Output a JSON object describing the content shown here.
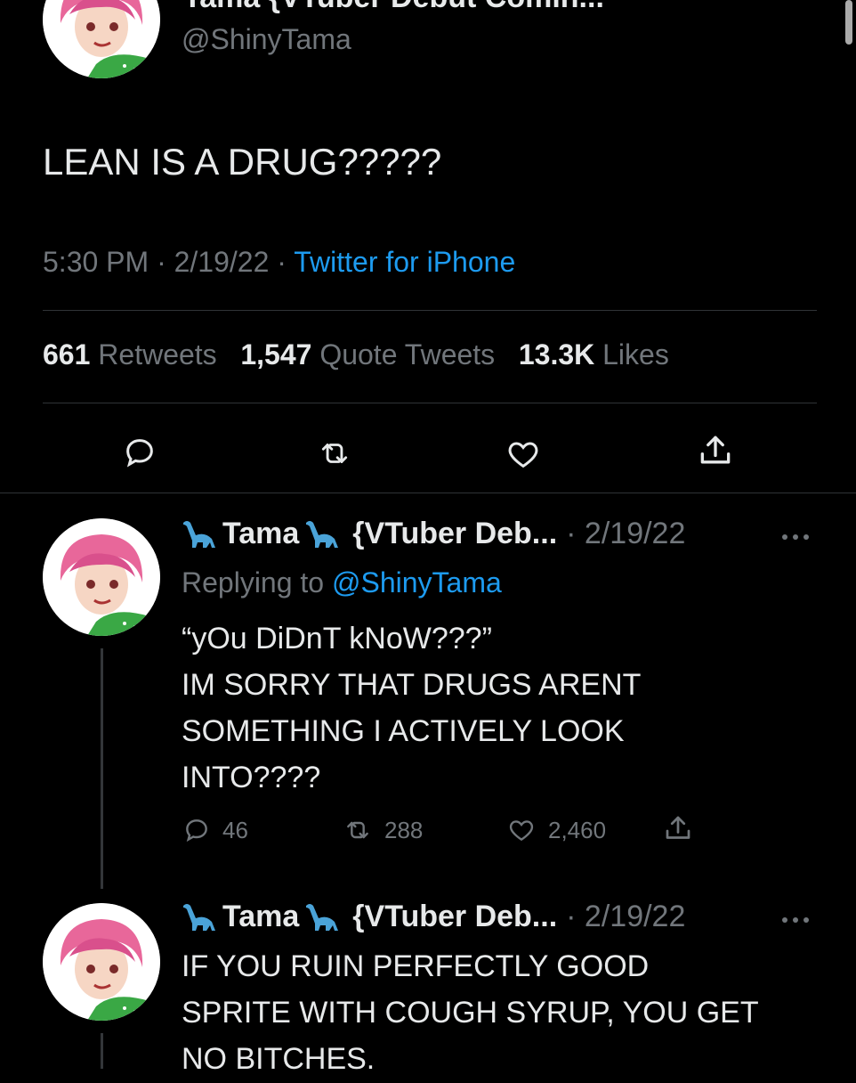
{
  "main_tweet": {
    "header_cut": "Tama  {VTuber Debut Comin...",
    "handle": "@ShinyTama",
    "text": "LEAN IS A DRUG?????",
    "time": "5:30 PM",
    "date": "2/19/22",
    "sep": "·",
    "source": "Twitter for iPhone",
    "stats": {
      "retweets_count": "661",
      "retweets_label": "Retweets",
      "quotes_count": "1,547",
      "quotes_label": "Quote Tweets",
      "likes_count": "13.3K",
      "likes_label": "Likes"
    }
  },
  "reply1": {
    "name": "Tama",
    "name_suffix": "{VTuber Deb...",
    "date": "· 2/19/22",
    "replying_prefix": "Replying to",
    "replying_handle": "@ShinyTama",
    "lines": [
      "“yOu DiDnT kNoW???”",
      "IM SORRY THAT DRUGS ARENT",
      "SOMETHING I ACTIVELY LOOK",
      "INTO????"
    ],
    "replies": "46",
    "retweets": "288",
    "likes": "2,460"
  },
  "reply2": {
    "name": "Tama",
    "name_suffix": "{VTuber Deb...",
    "date": "· 2/19/22",
    "lines": [
      "IF YOU RUIN PERFECTLY GOOD",
      "SPRITE WITH COUGH SYRUP, YOU GET",
      "NO BITCHES."
    ]
  },
  "icons": [
    "reply-icon",
    "retweet-icon",
    "like-icon",
    "share-icon",
    "more-icon",
    "dinosaur-emoji-icon",
    "avatar"
  ],
  "colors": {
    "background": "#000000",
    "text": "#e7e9ea",
    "muted": "#71767b",
    "link": "#1d9bf0"
  }
}
